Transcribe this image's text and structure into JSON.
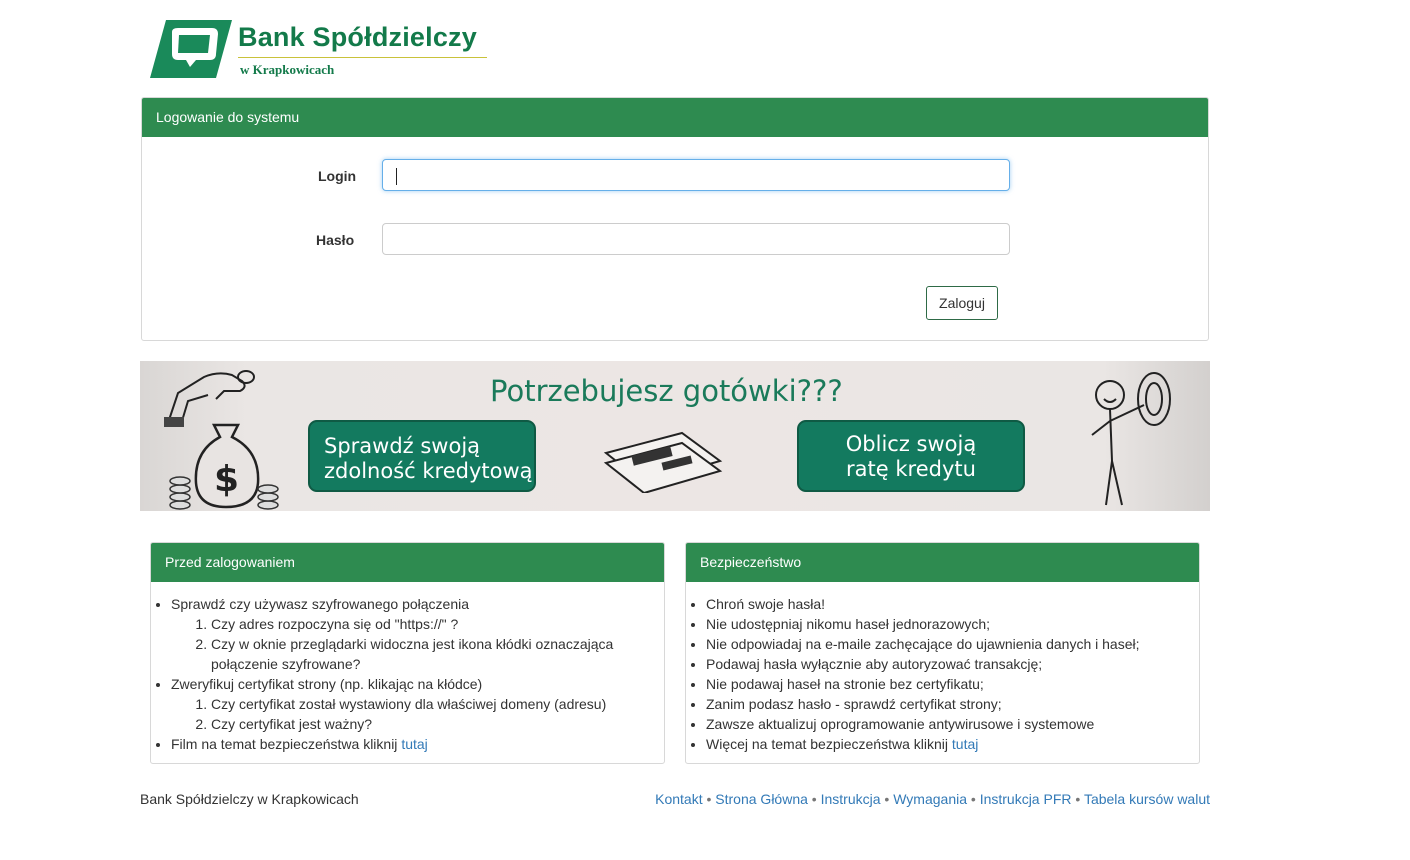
{
  "brand": {
    "name": "Bank Spółdzielczy",
    "subtitle": "w Krapkowicach",
    "color": "#137a4a"
  },
  "login_panel": {
    "title": "Logowanie do systemu",
    "login_label": "Login",
    "login_value": "",
    "password_label": "Hasło",
    "password_value": "",
    "submit_label": "Zaloguj"
  },
  "banner": {
    "title": "Potrzebujesz gotówki???",
    "button1": {
      "line1": "Sprawdź swoją",
      "line2": "zdolność kredytową"
    },
    "button2": {
      "line1": "Oblicz swoją",
      "line2": "ratę kredytu"
    }
  },
  "before_login": {
    "title": "Przed zalogowaniem",
    "item1": "Sprawdź czy używasz szyfrowanego połączenia",
    "item1_sub": [
      "Czy adres rozpoczyna się od \"https://\" ?",
      "Czy w oknie przeglądarki widoczna jest ikona kłódki oznaczająca połączenie szyfrowane?"
    ],
    "item2": "Zweryfikuj certyfikat strony (np. klikając na kłódce)",
    "item2_sub": [
      "Czy certyfikat został wystawiony dla właściwej domeny (adresu)",
      "Czy certyfikat jest ważny?"
    ],
    "item3": "Film na temat bezpieczeństwa kliknij",
    "item3_link": "tutaj"
  },
  "security": {
    "title": "Bezpieczeństwo",
    "items": [
      "Chroń swoje hasła!",
      "Nie udostępniaj nikomu haseł jednorazowych;",
      "Nie odpowiadaj na e-maile zachęcające do ujawnienia danych i haseł;",
      "Podawaj hasła wyłącznie aby autoryzować transakcję;",
      "Nie podawaj haseł na stronie bez certyfikatu;",
      "Zanim podasz hasło - sprawdź certyfikat strony;",
      "Zawsze aktualizuj oprogramowanie antywirusowe i systemowe"
    ],
    "last_item": "Więcej na temat bezpieczeństwa kliknij",
    "last_item_link": "tutaj"
  },
  "footer": {
    "left": "Bank Spółdzielczy w Krapkowicach",
    "links": [
      "Kontakt",
      "Strona Główna",
      "Instrukcja",
      "Wymagania",
      "Instrukcja PFR",
      "Tabela kursów walut"
    ],
    "separator": "•"
  },
  "colors": {
    "header_green": "#2e8b50",
    "banner_button": "#137a5f",
    "link": "#337ab7"
  }
}
